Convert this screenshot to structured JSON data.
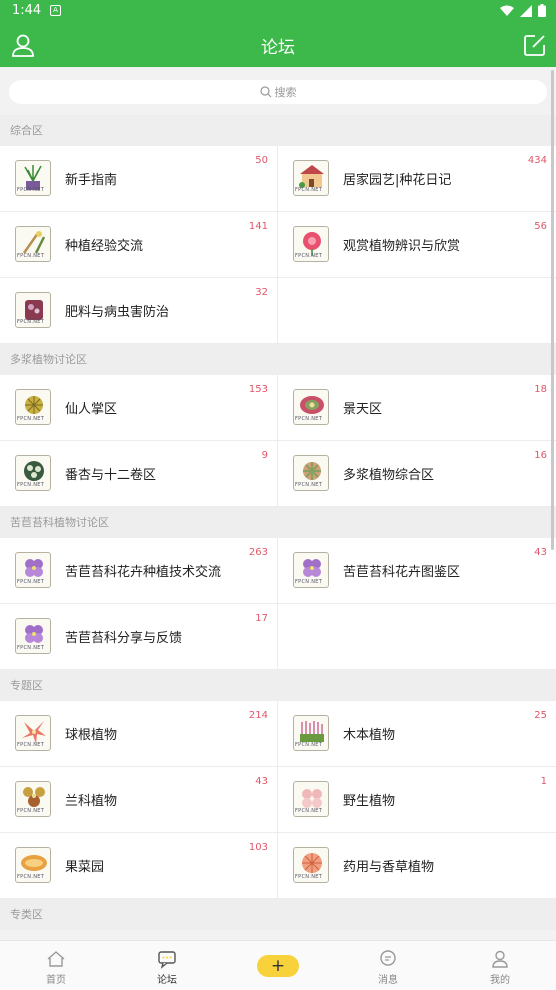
{
  "status_bar": {
    "time": "1:44",
    "app_badge": "A"
  },
  "app_bar": {
    "title": "论坛"
  },
  "search": {
    "placeholder": "搜索"
  },
  "sections": [
    {
      "title": "综合区",
      "items": [
        {
          "name": "新手指南",
          "count": "50",
          "icon": "plant-pot-icon"
        },
        {
          "name": "居家园艺|种花日记",
          "count": "434",
          "icon": "garden-house-icon"
        },
        {
          "name": "种植经验交流",
          "count": "141",
          "icon": "gardening-tools-icon"
        },
        {
          "name": "观赏植物辨识与欣赏",
          "count": "56",
          "icon": "flower-icon"
        },
        {
          "name": "肥料与病虫害防治",
          "count": "32",
          "icon": "fertilizer-icon"
        }
      ]
    },
    {
      "title": "多浆植物讨论区",
      "items": [
        {
          "name": "仙人掌区",
          "count": "153",
          "icon": "cactus-icon"
        },
        {
          "name": "景天区",
          "count": "18",
          "icon": "succulent-icon"
        },
        {
          "name": "番杏与十二卷区",
          "count": "9",
          "icon": "haworthia-icon"
        },
        {
          "name": "多浆植物综合区",
          "count": "16",
          "icon": "echeveria-icon"
        }
      ]
    },
    {
      "title": "苦苣苔科植物讨论区",
      "items": [
        {
          "name": "苦苣苔科花卉种植技术交流",
          "count": "263",
          "icon": "violet-flower-icon"
        },
        {
          "name": "苦苣苔科花卉图鉴区",
          "count": "43",
          "icon": "violet-flower-icon"
        },
        {
          "name": "苦苣苔科分享与反馈",
          "count": "17",
          "icon": "violet-flower-icon"
        }
      ]
    },
    {
      "title": "专题区",
      "items": [
        {
          "name": "球根植物",
          "count": "214",
          "icon": "lily-icon"
        },
        {
          "name": "木本植物",
          "count": "25",
          "icon": "shrub-icon"
        },
        {
          "name": "兰科植物",
          "count": "43",
          "icon": "orchid-icon"
        },
        {
          "name": "野生植物",
          "count": "1",
          "icon": "wildflower-icon"
        },
        {
          "name": "果菜园",
          "count": "103",
          "icon": "vegetable-icon"
        },
        {
          "name": "药用与香草植物",
          "count": "",
          "icon": "herb-flower-icon"
        }
      ]
    },
    {
      "title": "专类区",
      "items": []
    }
  ],
  "icon_tag": "FPCN.NET",
  "bottom_nav": {
    "home": "首页",
    "forum": "论坛",
    "add": "+",
    "messages": "消息",
    "mine": "我的"
  },
  "colors": {
    "primary": "#3cb94a",
    "count": "#e0566a",
    "add_button": "#f7d23a"
  }
}
